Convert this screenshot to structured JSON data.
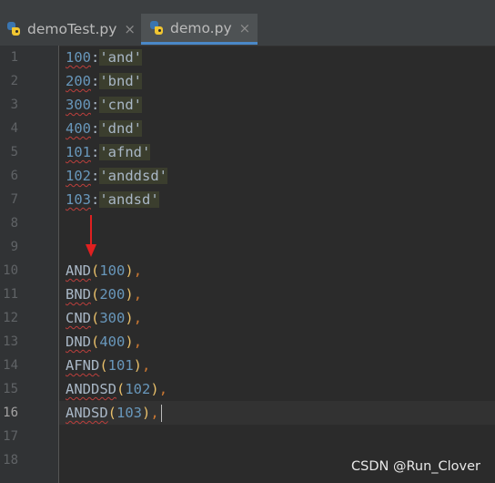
{
  "tabs": [
    {
      "label": "demoTest.py",
      "icon": "python-file-icon",
      "close": "×",
      "active": false
    },
    {
      "label": "demo.py",
      "icon": "python-file-icon",
      "close": "×",
      "active": true
    }
  ],
  "gutter": {
    "line_numbers": [
      "1",
      "2",
      "3",
      "4",
      "5",
      "6",
      "7",
      "8",
      "9",
      "10",
      "11",
      "12",
      "13",
      "14",
      "15",
      "16",
      "17",
      "18"
    ],
    "current_line": "16"
  },
  "code": {
    "mapping_lines": [
      {
        "num": "100",
        "colon": ":",
        "str": "'and'"
      },
      {
        "num": "200",
        "colon": ":",
        "str": "'bnd'"
      },
      {
        "num": "300",
        "colon": ":",
        "str": "'cnd'"
      },
      {
        "num": "400",
        "colon": ":",
        "str": "'dnd'"
      },
      {
        "num": "101",
        "colon": ":",
        "str": "'afnd'"
      },
      {
        "num": "102",
        "colon": ":",
        "str": "'anddsd'"
      },
      {
        "num": "103",
        "colon": ":",
        "str": "'andsd'"
      }
    ],
    "call_lines": [
      {
        "ident": "AND",
        "open": "(",
        "num": "100",
        "close": ")",
        "comma": ","
      },
      {
        "ident": "BND",
        "open": "(",
        "num": "200",
        "close": ")",
        "comma": ","
      },
      {
        "ident": "CND",
        "open": "(",
        "num": "300",
        "close": ")",
        "comma": ","
      },
      {
        "ident": "DND",
        "open": "(",
        "num": "400",
        "close": ")",
        "comma": ","
      },
      {
        "ident": "AFND",
        "open": "(",
        "num": "101",
        "close": ")",
        "comma": ","
      },
      {
        "ident": "ANDDSD",
        "open": "(",
        "num": "102",
        "close": ")",
        "comma": ","
      },
      {
        "ident": "ANDSD",
        "open": "(",
        "num": "103",
        "close": ")",
        "comma": ","
      }
    ]
  },
  "annotation": {
    "arrow_color": "#e02020",
    "arrow_icon": "down-arrow-icon"
  },
  "watermark": "CSDN @Run_Clover",
  "colors": {
    "background": "#2b2b2b",
    "gutter": "#313335",
    "tabbar": "#3c3f41",
    "tab_underline": "#4a88c7",
    "number": "#6897bb",
    "paren": "#e8bf6a",
    "comma": "#cc7832",
    "text": "#a9b7c6"
  }
}
